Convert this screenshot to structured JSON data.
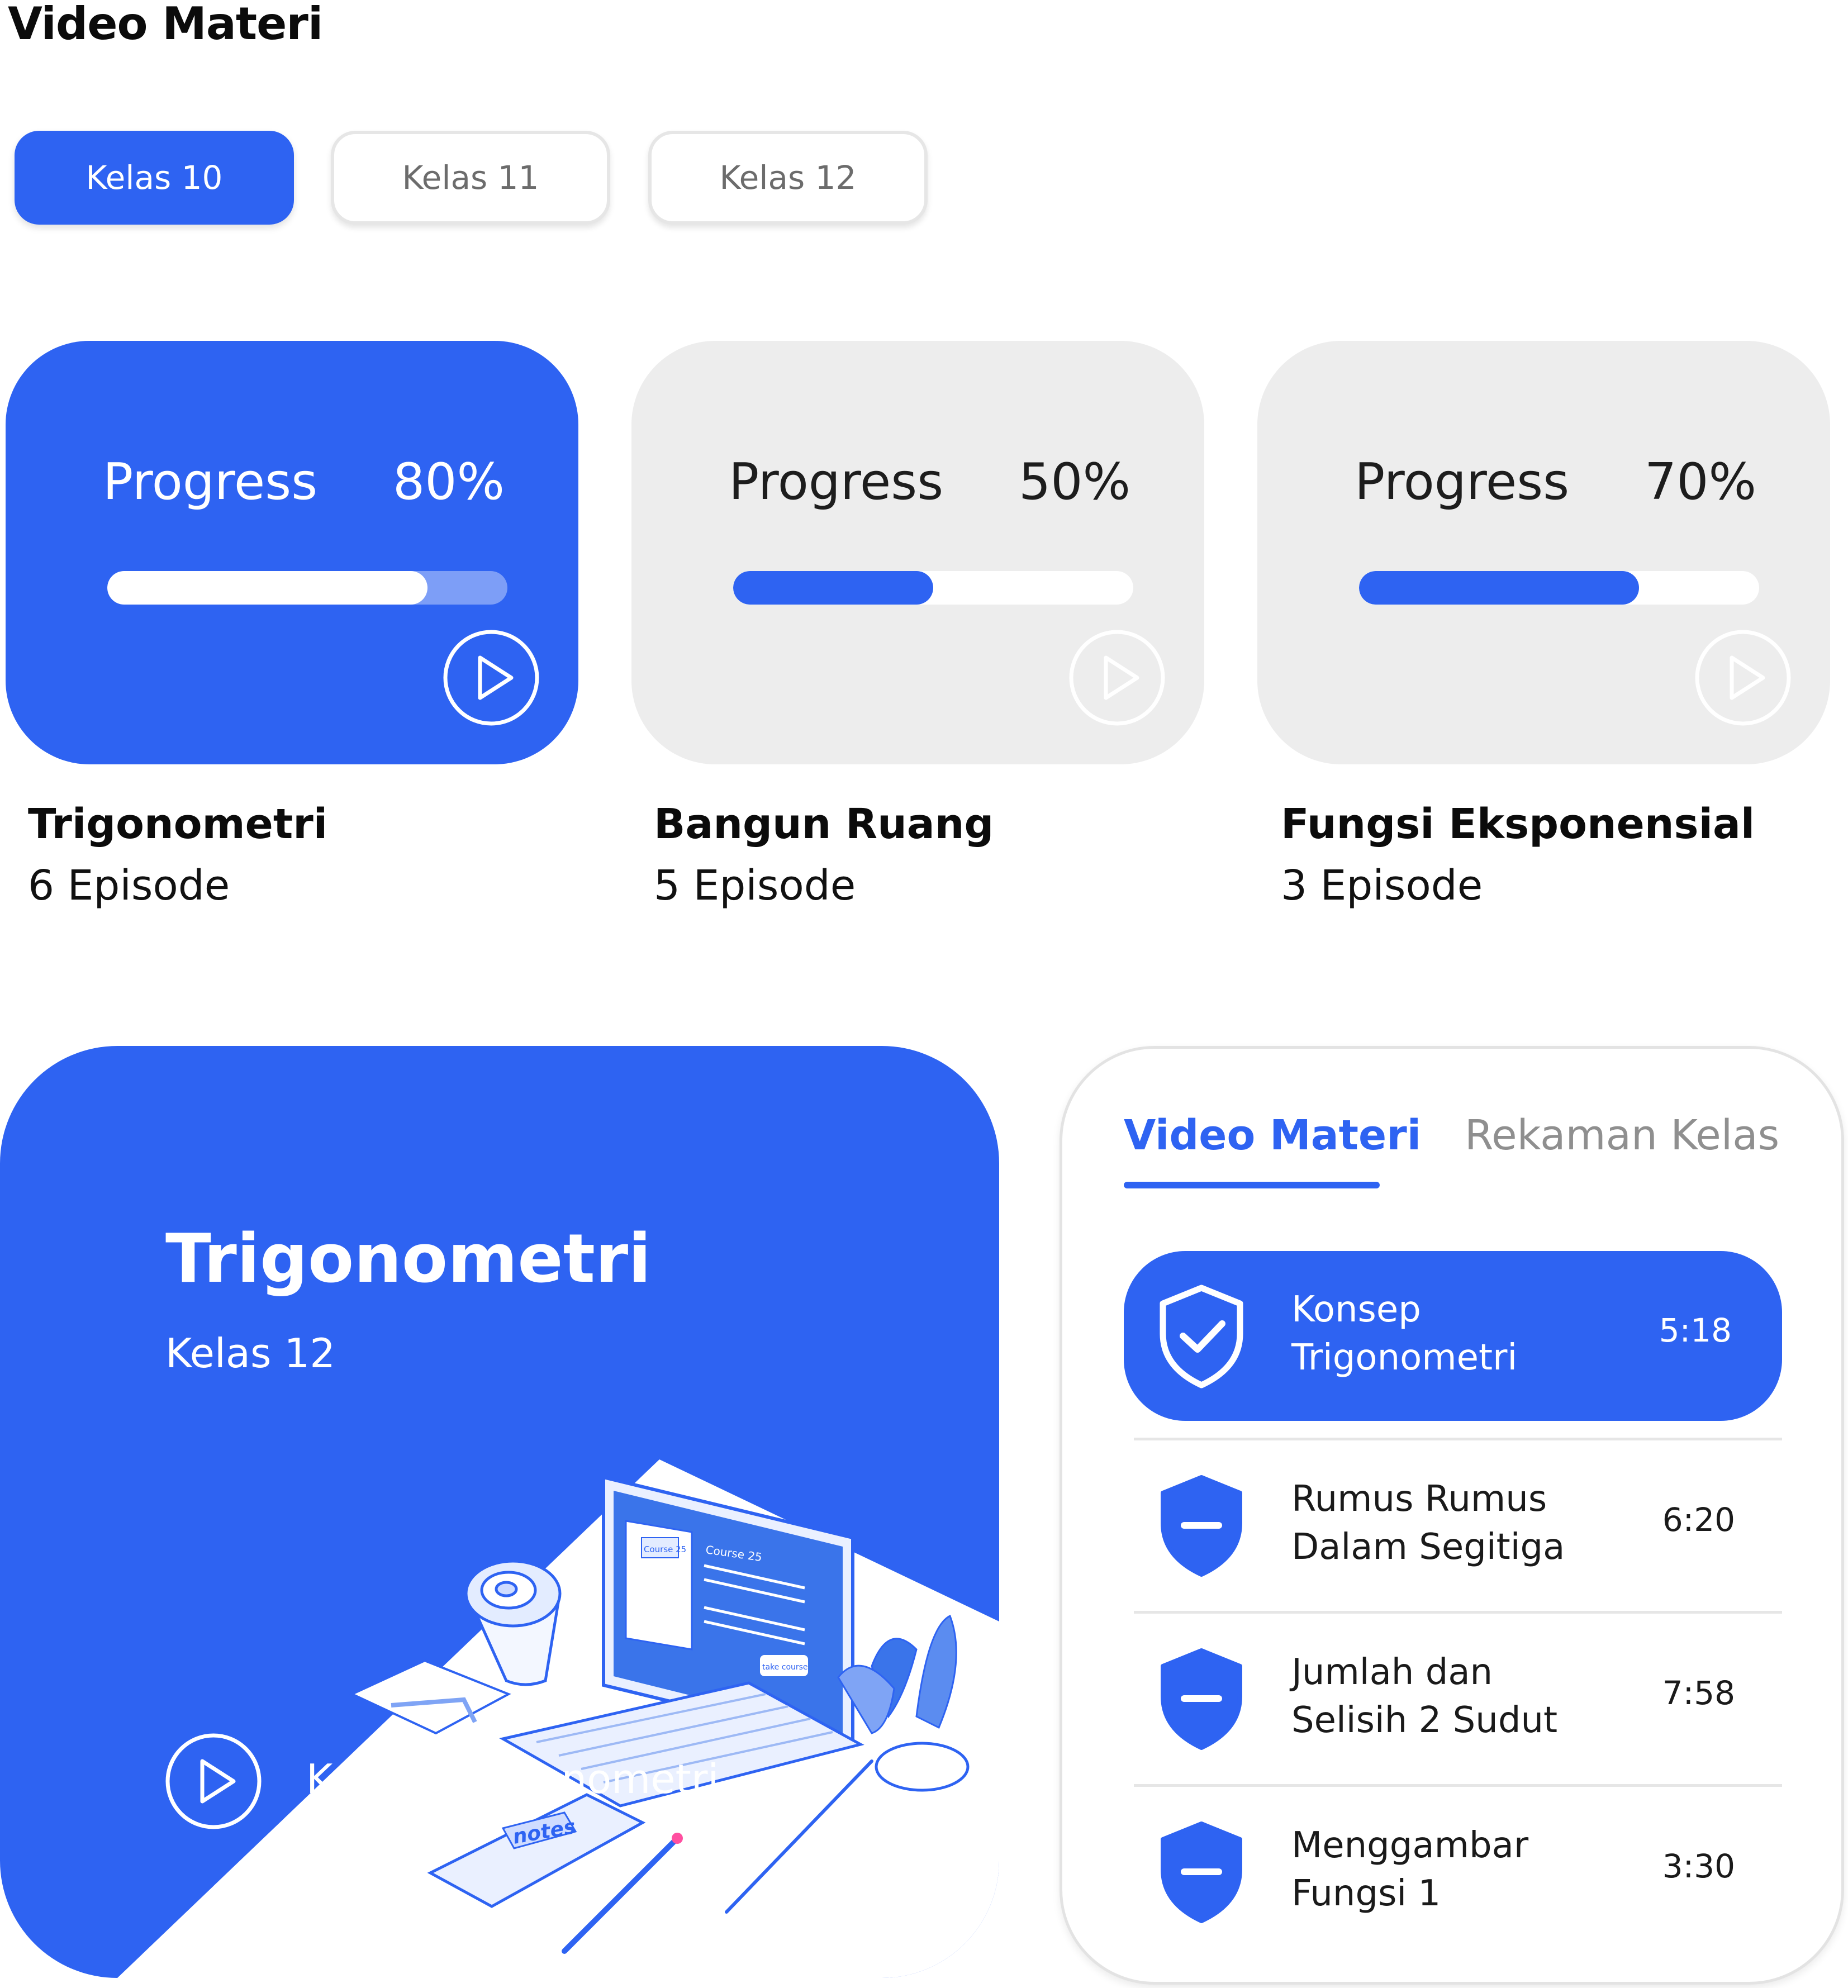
{
  "header": {
    "title": "Video Materi"
  },
  "grade_tabs": [
    {
      "label": "Kelas 10",
      "active": true
    },
    {
      "label": "Kelas 11",
      "active": false
    },
    {
      "label": "Kelas 12",
      "active": false
    }
  ],
  "courses": [
    {
      "progress_label": "Progress",
      "progress_text": "80%",
      "progress": 0.8,
      "name": "Trigonometri",
      "episodes": "6 Episode",
      "active": true
    },
    {
      "progress_label": "Progress",
      "progress_text": "50%",
      "progress": 0.5,
      "name": "Bangun Ruang",
      "episodes": "5 Episode",
      "active": false
    },
    {
      "progress_label": "Progress",
      "progress_text": "70%",
      "progress": 0.7,
      "name": "Fungsi Eksponensial",
      "episodes": "3 Episode",
      "active": false
    }
  ],
  "hero": {
    "title": "Trigonometri",
    "subtitle": "Kelas 12",
    "caption": "Konsep Trigonometri",
    "art_labels": {
      "card": "Course 25",
      "screen": "Course 25",
      "button": "take course",
      "notebook": "notes"
    }
  },
  "panel": {
    "tabs": [
      {
        "label": "Video Materi",
        "active": true
      },
      {
        "label": "Rekaman Kelas",
        "active": false
      }
    ],
    "episodes": [
      {
        "line1": "Konsep",
        "line2": "Trigonometri",
        "time": "5:18",
        "status": "completed",
        "active": true
      },
      {
        "line1": "Rumus Rumus",
        "line2": "Dalam Segitiga",
        "time": "6:20",
        "status": "locked",
        "active": false
      },
      {
        "line1": "Jumlah dan",
        "line2": "Selisih 2 Sudut",
        "time": "7:58",
        "status": "locked",
        "active": false
      },
      {
        "line1": "Menggambar",
        "line2": "Fungsi 1",
        "time": "3:30",
        "status": "locked",
        "active": false
      }
    ]
  },
  "colors": {
    "primary": "#2E63F2",
    "card_grey": "#EDEDED",
    "muted_text": "#8F8F8F"
  },
  "icons": {
    "play": "play-icon",
    "shield_check": "shield-check-icon",
    "shield_minus": "shield-minus-icon"
  }
}
